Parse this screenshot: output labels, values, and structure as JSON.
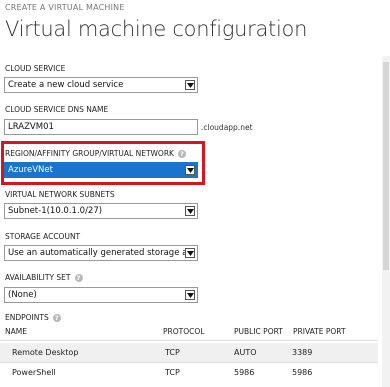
{
  "wizard_step": "CREATE A VIRTUAL MACHINE",
  "title": "Virtual machine configuration",
  "cloud_service": {
    "label": "CLOUD SERVICE",
    "value": "Create a new cloud service"
  },
  "dns_name": {
    "label": "CLOUD SERVICE DNS NAME",
    "value": "LRAZVM01",
    "suffix": ".cloudapp.net"
  },
  "region": {
    "label": "REGION/AFFINITY GROUP/VIRTUAL NETWORK",
    "value": "AzureVNet"
  },
  "subnets": {
    "label": "VIRTUAL NETWORK SUBNETS",
    "value": "Subnet-1(10.0.1.0/27)"
  },
  "storage": {
    "label": "STORAGE ACCOUNT",
    "value": "Use an automatically generated storage account"
  },
  "availability": {
    "label": "AVAILABILITY SET",
    "value": "(None)"
  },
  "endpoints": {
    "label": "ENDPOINTS",
    "columns": [
      "NAME",
      "PROTOCOL",
      "PUBLIC PORT",
      "PRIVATE PORT"
    ],
    "rows": [
      {
        "name": "Remote Desktop",
        "protocol": "TCP",
        "public_port": "AUTO",
        "private_port": "3389"
      },
      {
        "name": "PowerShell",
        "protocol": "TCP",
        "public_port": "5986",
        "private_port": "5986"
      }
    ]
  },
  "colors": {
    "highlight_border": "#d4171e",
    "selected_bg": "#1874cd"
  },
  "icons": {
    "help": "question-mark-circle-icon",
    "dropdown": "chevron-down-icon"
  }
}
